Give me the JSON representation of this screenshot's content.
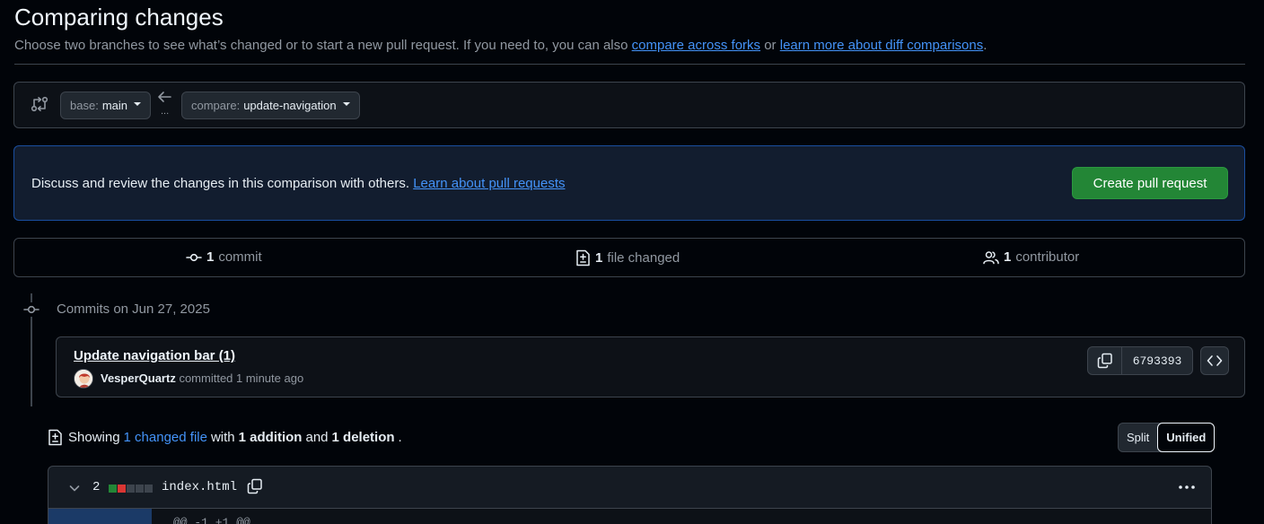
{
  "header": {
    "title": "Comparing changes",
    "subtitle_prefix": "Choose two branches to see what’s changed or to start a new pull request. If you need to, you can also ",
    "compare_forks_link": "compare across forks",
    "subtitle_or": " or ",
    "learn_diff_link": "learn more about diff comparisons",
    "subtitle_end": "."
  },
  "range": {
    "base_label": "base:",
    "base_value": "main",
    "compare_label": "compare:",
    "compare_value": "update-navigation",
    "dots": "..."
  },
  "flash": {
    "text": "Discuss and review the changes in this comparison with others. ",
    "link": "Learn about pull requests",
    "button": "Create pull request"
  },
  "stats": {
    "commits_count": "1",
    "commits_label": "commit",
    "files_count": "1",
    "files_label": "file changed",
    "contributors_count": "1",
    "contributors_label": "contributor"
  },
  "commits": {
    "date_heading": "Commits on Jun 27, 2025",
    "items": [
      {
        "title": "Update navigation bar (1)",
        "author": "VesperQuartz",
        "action": " committed 1 minute ago",
        "sha": "6793393"
      }
    ]
  },
  "diff_summary": {
    "showing": "Showing",
    "changed_file": "1 changed file",
    "with": "with",
    "additions": "1 addition",
    "and": "and",
    "deletions": "1 deletion",
    "end": "."
  },
  "view_toggle": {
    "split": "Split",
    "unified": "Unified",
    "selected": "Unified"
  },
  "file": {
    "change_count": "2",
    "name": "index.html",
    "hunk": "@@ -1 +1 @@",
    "diffstat_colors": [
      "#238636",
      "#da3633",
      "#3d444d",
      "#3d444d",
      "#3d444d"
    ]
  },
  "colors": {
    "accent": "#4493f8",
    "success": "#238636",
    "background": "#010409"
  }
}
